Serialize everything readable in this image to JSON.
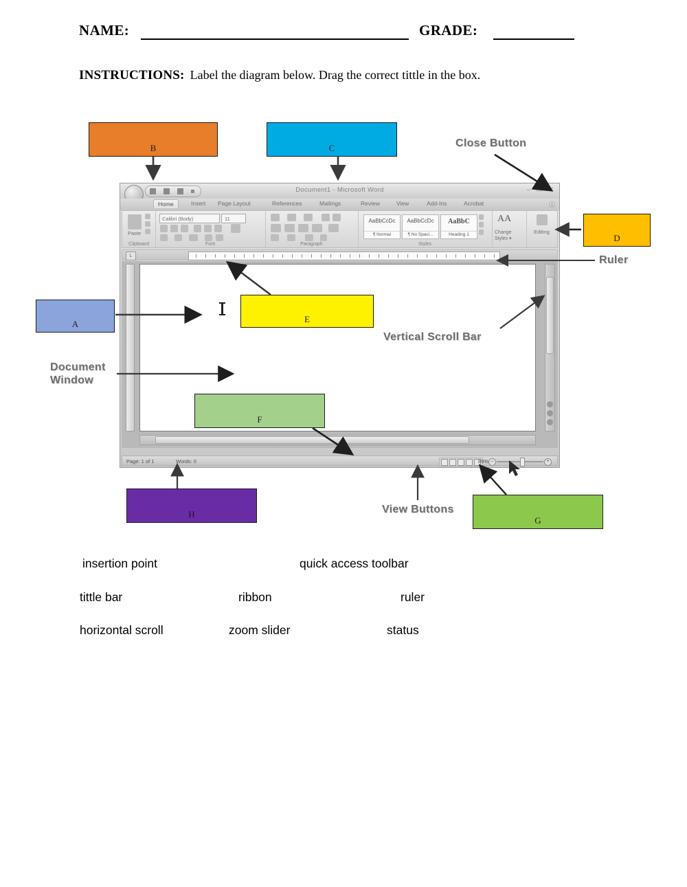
{
  "header": {
    "name_label": "NAME:",
    "grade_label": "GRADE:",
    "instructions_label": "INSTRUCTIONS:",
    "instructions_text": "Label the diagram below. Drag the correct tittle in the box."
  },
  "answer_boxes": [
    {
      "letter": "A",
      "color": "#8CA4DC",
      "points_to": "insertion-point"
    },
    {
      "letter": "B",
      "color": "#E87D2A",
      "points_to": "quick-access-toolbar"
    },
    {
      "letter": "C",
      "color": "#00ABE4",
      "points_to": "title-bar"
    },
    {
      "letter": "D",
      "color": "#FFBE00",
      "points_to": "ribbon"
    },
    {
      "letter": "E",
      "color": "#FFF200",
      "points_to": "ruler"
    },
    {
      "letter": "F",
      "color": "#A3D18C",
      "points_to": "horizontal-scroll-bar"
    },
    {
      "letter": "G",
      "color": "#8CC84B",
      "points_to": "zoom-slider"
    },
    {
      "letter": "H",
      "color": "#6A2CA5",
      "points_to": "status-bar"
    }
  ],
  "callouts": [
    {
      "id": "close-button",
      "text": "Close Button"
    },
    {
      "id": "ruler",
      "text": "Ruler"
    },
    {
      "id": "vertical-scroll-bar",
      "text": "Vertical Scroll Bar"
    },
    {
      "id": "document-window",
      "line1": "Document",
      "line2": "Window"
    },
    {
      "id": "view-buttons",
      "text": "View Buttons"
    }
  ],
  "word_bank": [
    {
      "text": "insertion  point"
    },
    {
      "text": "quick  access  toolbar"
    },
    {
      "text": "tittle  bar"
    },
    {
      "text": "ribbon"
    },
    {
      "text": "ruler"
    },
    {
      "text": "horizontal scroll"
    },
    {
      "text": "zoom slider"
    },
    {
      "text": "status"
    }
  ],
  "word_window": {
    "title": "Document1 - Microsoft Word",
    "window_buttons": {
      "minimize": "–",
      "restore": "▭",
      "close": "✕"
    },
    "tabs": [
      "Home",
      "Insert",
      "Page Layout",
      "References",
      "Mailings",
      "Review",
      "View",
      "Add-Ins",
      "Acrobat"
    ],
    "active_tab": "Home",
    "ribbon_groups": [
      {
        "name": "Clipboard",
        "paste_label": "Paste"
      },
      {
        "name": "Font",
        "font_name": "Calibri (Body)",
        "font_size": "11"
      },
      {
        "name": "Paragraph"
      },
      {
        "name": "Styles"
      },
      {
        "name": "Editing"
      }
    ],
    "style_cards": [
      {
        "sample": "AaBbCcDc",
        "name": "¶ Normal"
      },
      {
        "sample": "AaBbCcDc",
        "name": "¶ No Spaci..."
      },
      {
        "sample": "AaBbC",
        "name": "Heading 1"
      }
    ],
    "change_styles_label": "Change\nStyles ▾",
    "editing_label": "Editing",
    "tab_selector": "L",
    "status": {
      "page": "Page: 1 of 1",
      "words": "Words: 0",
      "zoom": "89%",
      "zoom_out": "–",
      "zoom_in": "+"
    }
  }
}
